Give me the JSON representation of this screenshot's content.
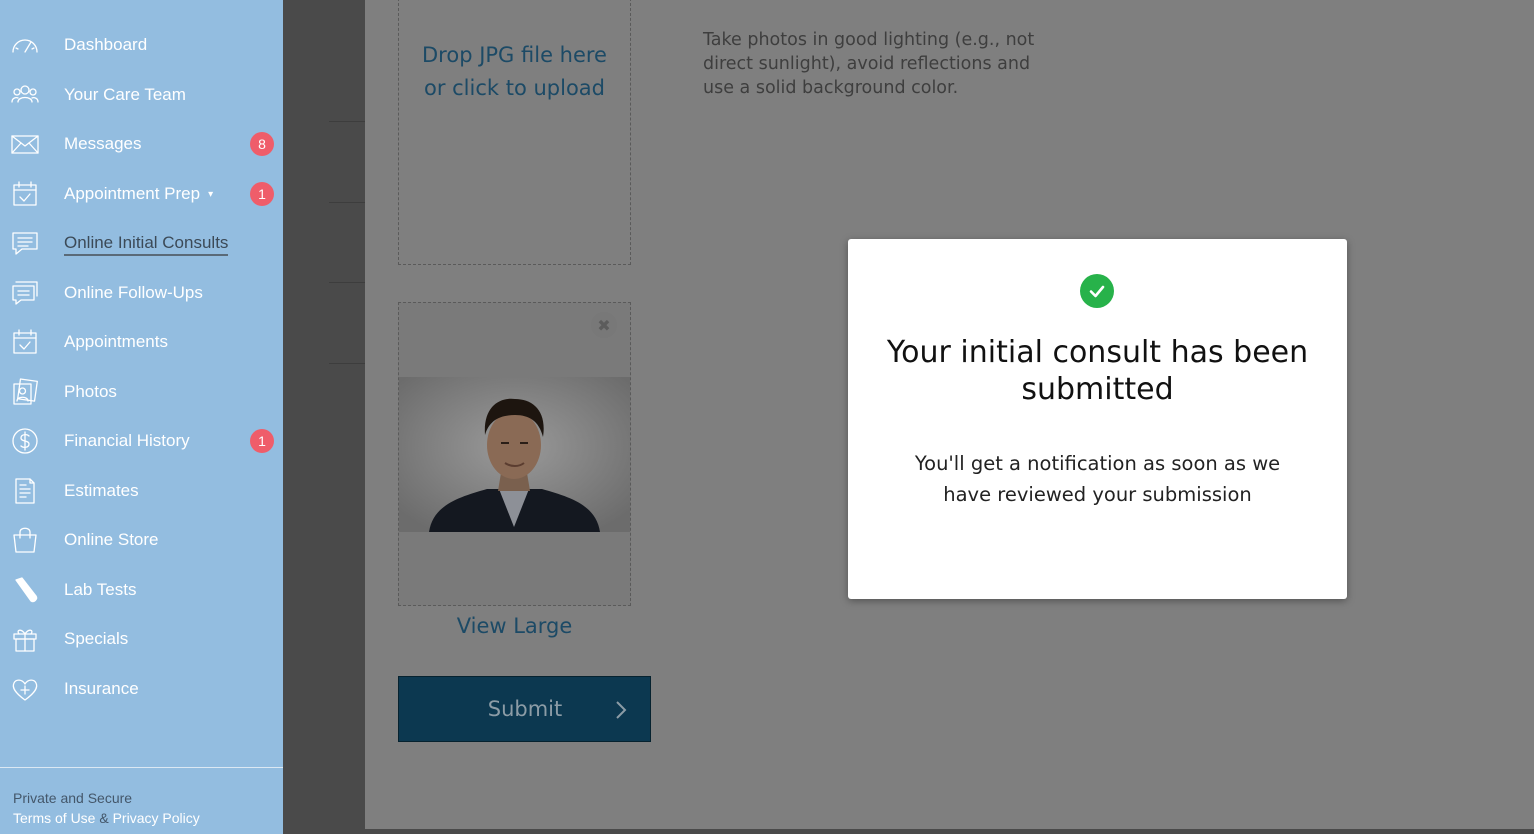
{
  "sidebar": {
    "items": [
      {
        "label": "Dashboard",
        "icon": "gauge-icon"
      },
      {
        "label": "Your Care Team",
        "icon": "team-icon"
      },
      {
        "label": "Messages",
        "icon": "envelope-icon",
        "badge": "8"
      },
      {
        "label": "Appointment Prep",
        "icon": "calendar-check-icon",
        "badge": "1",
        "caret": "▾"
      },
      {
        "label": "Online Initial Consults",
        "icon": "chat-icon",
        "active": true
      },
      {
        "label": "Online Follow-Ups",
        "icon": "chat-multi-icon"
      },
      {
        "label": "Appointments",
        "icon": "calendar-check-icon"
      },
      {
        "label": "Photos",
        "icon": "photos-icon"
      },
      {
        "label": "Financial History",
        "icon": "dollar-icon",
        "badge": "1"
      },
      {
        "label": "Estimates",
        "icon": "estimate-icon"
      },
      {
        "label": "Online Store",
        "icon": "bag-icon"
      },
      {
        "label": "Lab Tests",
        "icon": "test-tube-icon"
      },
      {
        "label": "Specials",
        "icon": "gift-icon"
      },
      {
        "label": "Insurance",
        "icon": "heart-plus-icon"
      }
    ],
    "footer": {
      "secure_text": "Private and Secure",
      "terms_label": "Terms of Use",
      "amp": "&",
      "privacy_label": "Privacy Policy"
    }
  },
  "upload": {
    "drop_text_line1": "Drop JPG file here",
    "drop_text_line2": "or click to upload",
    "instructions": "Take photos in good lighting (e.g., not direct sunlight), avoid reflections and use a solid background color.",
    "remove_symbol": "✖",
    "view_large_label": "View Large",
    "submit_label": "Submit"
  },
  "modal": {
    "title": "Your initial consult has been submitted",
    "body": "You'll get a notification as soon as we have reviewed your submission"
  },
  "colors": {
    "sidebar_bg": "#93bde0",
    "badge": "#ef5d6a",
    "success": "#27b24a",
    "submit_bg": "#0c3850"
  }
}
